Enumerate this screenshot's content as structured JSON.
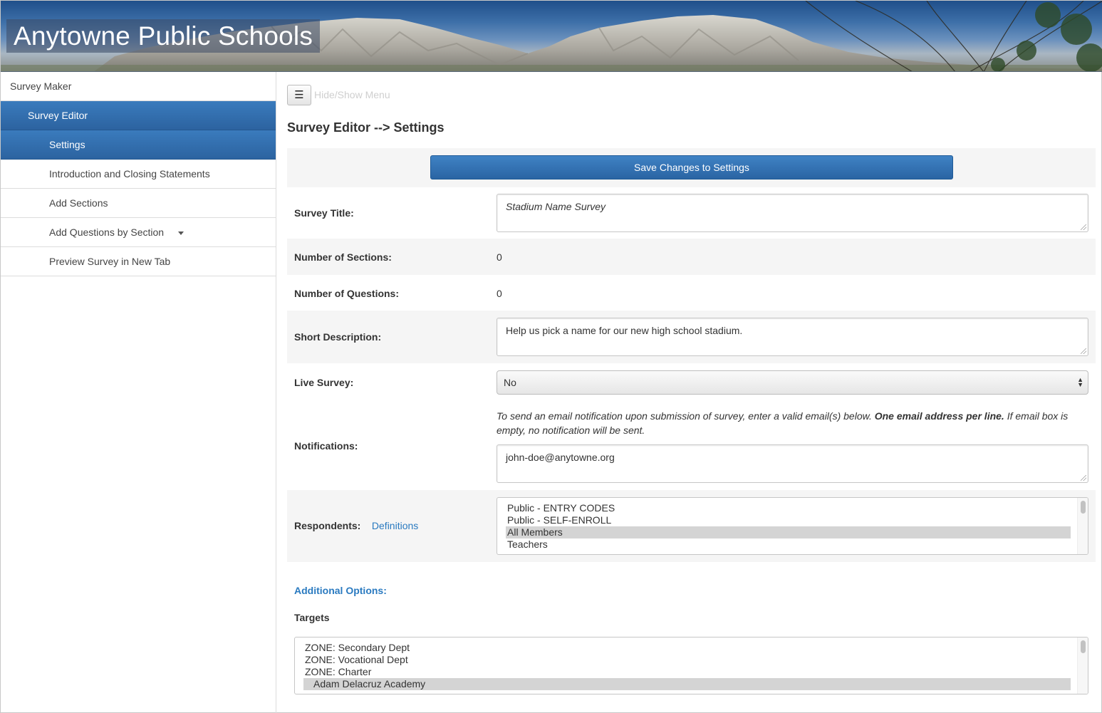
{
  "header": {
    "title": "Anytowne Public Schools"
  },
  "sidebar": {
    "items": [
      {
        "label": "Survey Maker"
      },
      {
        "label": "Survey Editor"
      },
      {
        "label": "Settings"
      },
      {
        "label": "Introduction and Closing Statements"
      },
      {
        "label": "Add Sections"
      },
      {
        "label": "Add Questions by Section"
      },
      {
        "label": "Preview Survey in New Tab"
      }
    ]
  },
  "toolbar": {
    "menu_icon": "☰",
    "menu_label": "Hide/Show Menu"
  },
  "page": {
    "title": "Survey Editor --> Settings"
  },
  "save_button": "Save Changes to Settings",
  "form": {
    "survey_title": {
      "label": "Survey Title:",
      "value": "Stadium Name Survey"
    },
    "num_sections": {
      "label": "Number of Sections:",
      "value": "0"
    },
    "num_questions": {
      "label": "Number of Questions:",
      "value": "0"
    },
    "short_description": {
      "label": "Short Description:",
      "value": "Help us pick a name for our new high school stadium."
    },
    "live_survey": {
      "label": "Live Survey:",
      "value": "No"
    },
    "notifications": {
      "label": "Notifications:",
      "note_part1": "To send an email notification upon submission of survey, enter a valid email(s) below. ",
      "note_bold": "One email address per line.",
      "note_part2": " If email box is empty, no notification will be sent.",
      "value": "john-doe@anytowne.org"
    },
    "respondents": {
      "label": "Respondents:",
      "link": "Definitions",
      "options": [
        "Public - ENTRY CODES",
        "Public - SELF-ENROLL",
        "All Members",
        "Teachers"
      ],
      "selected": "All Members"
    },
    "additional_options": "Additional Options:",
    "targets": {
      "label": "Targets",
      "options": [
        "ZONE: Secondary Dept",
        "ZONE: Vocational Dept",
        "ZONE: Charter",
        "Adam Delacruz Academy"
      ],
      "selected": "Adam Delacruz Academy"
    }
  },
  "colors": {
    "accent": "#2c63a0",
    "link": "#2a7ac0"
  }
}
